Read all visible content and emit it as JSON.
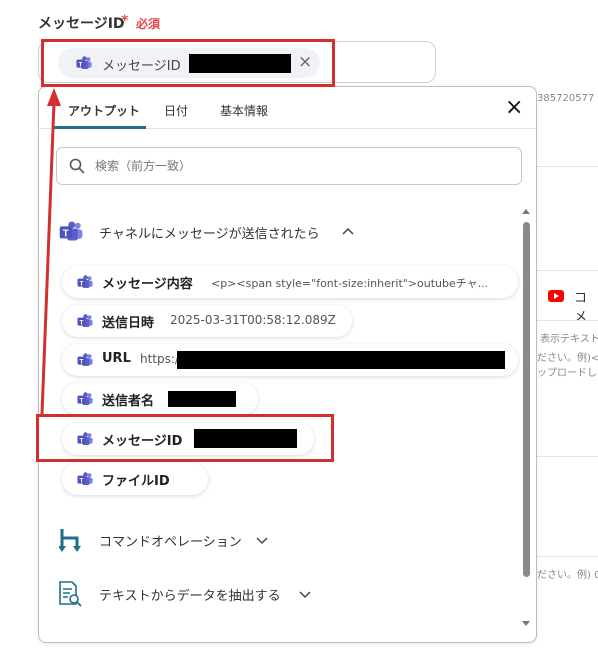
{
  "field": {
    "label": "メッセージID",
    "required_star": "*",
    "required_text": "必須"
  },
  "selected_chip": {
    "label": "メッセージID",
    "remove_icon": "×"
  },
  "background": {
    "right_number": "385720577",
    "youtube_label": "コメ",
    "hint_1": "表示テキスト",
    "hint_2": "ださい。例)<",
    "hint_3": "ップロードし",
    "hint_4": "ださい。例) 0"
  },
  "tabs": [
    {
      "label": "アウトプット",
      "active": true
    },
    {
      "label": "日付",
      "active": false
    },
    {
      "label": "基本情報",
      "active": false
    }
  ],
  "close_label": "×",
  "search": {
    "placeholder": "検索（前方一致）"
  },
  "section_teams": {
    "label": "チャネルにメッセージが送信されたら",
    "caret": "^"
  },
  "items": [
    {
      "label": "メッセージ内容",
      "value": "<p><span style=\"font-size:inherit\">outubeチャ..."
    },
    {
      "label": "送信日時",
      "value": "2025-03-31T00:58:12.089Z"
    },
    {
      "label": "URL",
      "value": "https:/"
    },
    {
      "label": "送信者名",
      "value": ""
    },
    {
      "label": "メッセージID",
      "value": ""
    },
    {
      "label": "ファイルID",
      "value": ""
    }
  ],
  "section_command": {
    "label": "コマンドオペレーション",
    "caret": "v"
  },
  "section_extract": {
    "label": "テキストからデータを抽出する",
    "caret": "v"
  },
  "colors": {
    "accent": "#1f6f8b",
    "required": "#e5484d",
    "annotation": "#d32f2f",
    "teams": "#5b5fc7"
  }
}
